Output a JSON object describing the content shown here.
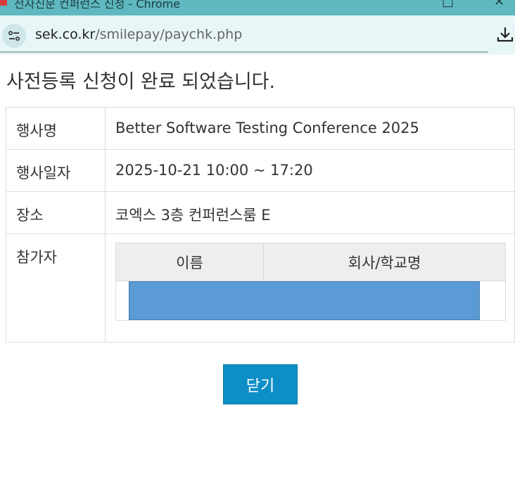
{
  "window": {
    "title": "전자신문 컨퍼런스 신청 - Chrome"
  },
  "address": {
    "host": "sek.co.kr",
    "path": "/smilepay/paychk.php"
  },
  "page": {
    "heading": "사전등록 신청이 완료 되었습니다.",
    "rows": {
      "event_label": "행사명",
      "event_value": "Better Software Testing Conference 2025",
      "date_label": "행사일자",
      "date_value": "2025-10-21 10:00 ~ 17:20",
      "place_label": "장소",
      "place_value": "코엑스 3층 컨퍼런스룸 E",
      "participant_label": "참가자"
    },
    "participants": {
      "col_name": "이름",
      "col_company": "회사/학교명"
    },
    "close_label": "닫기"
  }
}
